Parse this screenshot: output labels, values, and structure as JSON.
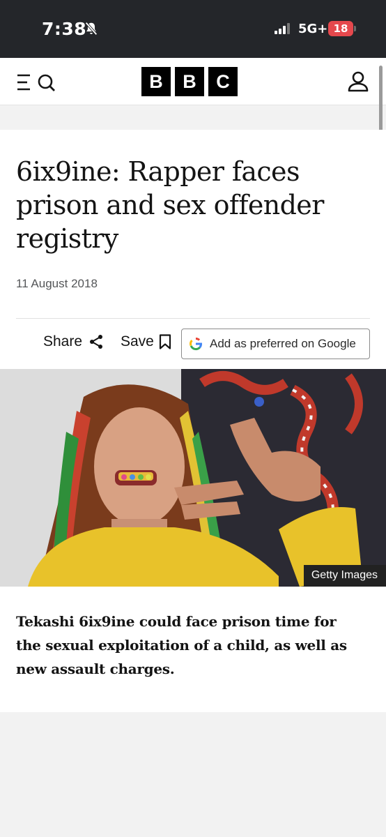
{
  "status_bar": {
    "time": "7:38",
    "network": "5G+",
    "battery": "18"
  },
  "header": {
    "logo_letters": [
      "B",
      "B",
      "C"
    ]
  },
  "article": {
    "headline": "6ix9ine: Rapper faces prison and sex offender registry",
    "date": "11 August 2018",
    "share_label": "Share",
    "save_label": "Save",
    "google_label": "Add as preferred on Google",
    "image_credit": "Getty Images",
    "summary": "Tekashi 6ix9ine could face prison time for the sexual exploitation of a child, as well as new assault charges."
  },
  "icons": {
    "bell_muted": "bell-slash-icon",
    "menu": "menu-search-icon",
    "account": "user-icon",
    "share": "share-icon",
    "save": "bookmark-icon",
    "google": "google-g-icon"
  },
  "colors": {
    "status_bar_bg": "#24262a",
    "battery_bg": "#e5484d",
    "logo_bg": "#000000",
    "page_bg": "#f2f2f2"
  }
}
